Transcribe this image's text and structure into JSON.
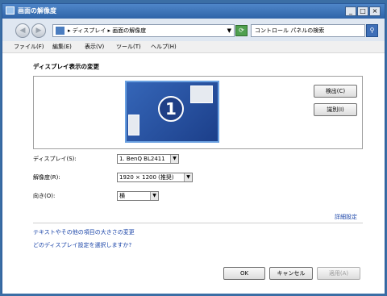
{
  "window": {
    "title": "画面の解像度",
    "minimize": "_",
    "maximize": "□",
    "close": "×"
  },
  "nav": {
    "back": "◀",
    "forward": "▶",
    "address": "▸ ディスプレイ ▸ 画面の解像度",
    "dropdown": "▼",
    "refresh": "⟳",
    "search_placeholder": "コントロール パネルの検索",
    "search_icon": "⚲"
  },
  "menu": [
    "ファイル(F)",
    "編集(E)",
    "表示(V)",
    "ツール(T)",
    "ヘルプ(H)"
  ],
  "main": {
    "heading": "ディスプレイ表示の変更",
    "monitor_number": "1",
    "detect_button": "検出(C)",
    "identify_button": "識別(I)",
    "display_label": "ディスプレイ(S):",
    "display_value": "1. BenQ BL2411",
    "resolution_label": "解像度(R):",
    "resolution_value": "1920 × 1200 (推奨)",
    "orientation_label": "向き(O):",
    "orientation_value": "横",
    "advanced_link": "詳細設定",
    "link_text_size": "テキストやその他の項目の大きさの変更",
    "link_which_display": "どのディスプレイ設定を選択しますか?",
    "ok_button": "OK",
    "cancel_button": "キャンセル",
    "apply_button": "適用(A)"
  },
  "colors": {
    "titlebar": "#2e63a7",
    "link": "#1a44a8",
    "monitor": "#3566b8"
  }
}
